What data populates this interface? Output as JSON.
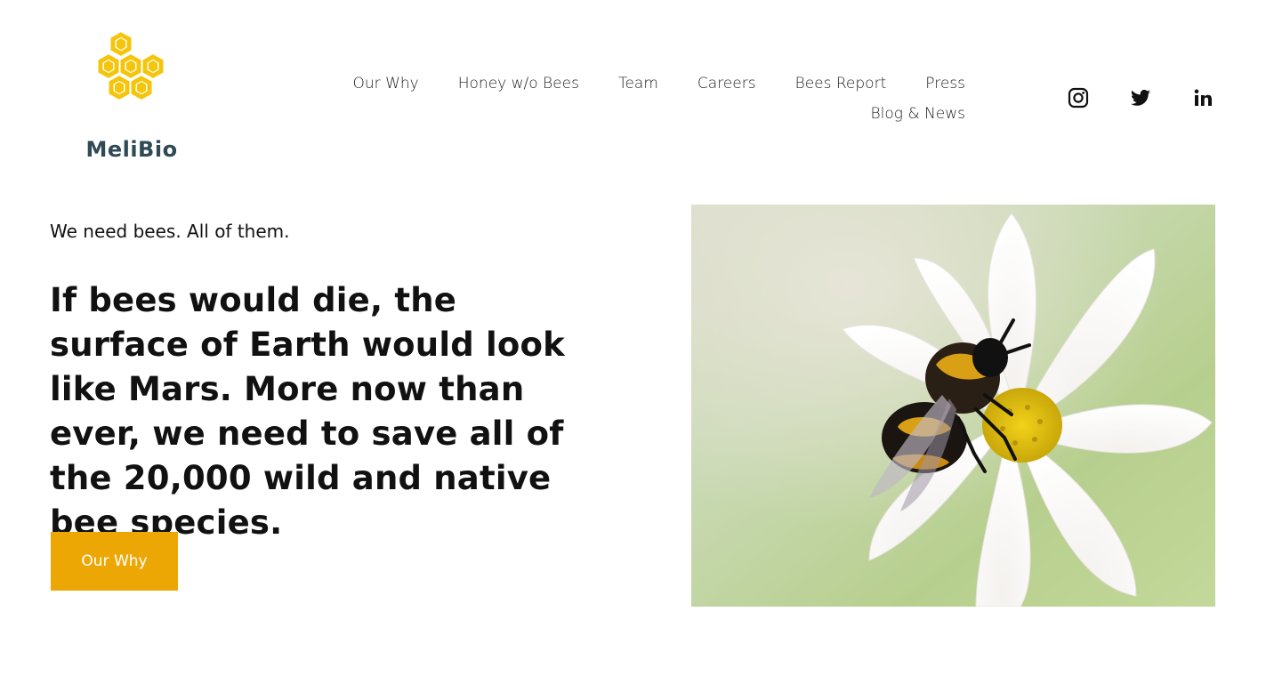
{
  "brand": {
    "name": "MeliBio",
    "logo_color": "#f5c50c",
    "text_color": "#2f4a56"
  },
  "nav": {
    "items": [
      {
        "label": "Our Why"
      },
      {
        "label": "Honey w/o Bees"
      },
      {
        "label": "Team"
      },
      {
        "label": "Careers"
      },
      {
        "label": "Bees Report"
      },
      {
        "label": "Press"
      },
      {
        "label": "Blog & News"
      }
    ]
  },
  "social": {
    "icons": [
      "instagram-icon",
      "twitter-icon",
      "linkedin-icon"
    ]
  },
  "hero": {
    "tagline": "We need bees. All of them.",
    "headline": "If bees would die, the surface of Earth would look like Mars. More now than ever, we need to save all of the 20,000 wild and native bee species.",
    "cta_label": "Our Why",
    "cta_color": "#eda705",
    "image": "bumblebee-on-white-flower"
  }
}
